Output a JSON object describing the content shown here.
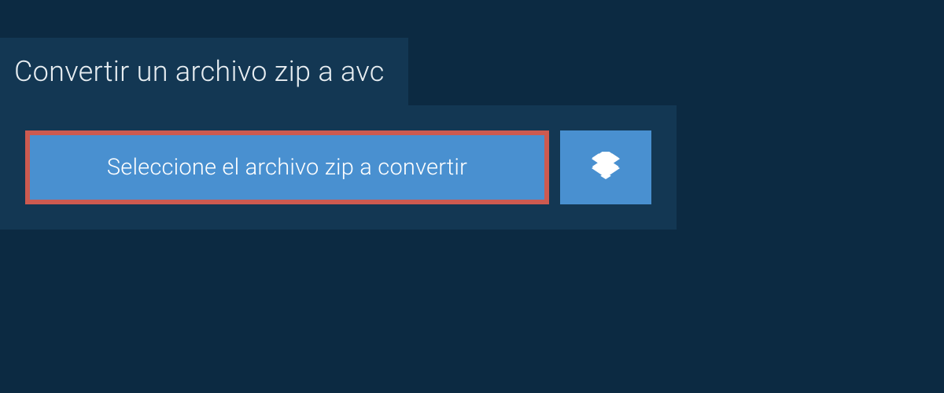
{
  "header": {
    "title": "Convertir un archivo zip a avc"
  },
  "actions": {
    "select_file_label": "Seleccione el archivo zip a convertir",
    "dropbox_icon": "dropbox-icon"
  },
  "colors": {
    "page_bg": "#0c2a42",
    "panel_bg": "#133753",
    "button_bg": "#4990d0",
    "highlight_border": "#cd5a50",
    "text_light": "#ffffff"
  }
}
